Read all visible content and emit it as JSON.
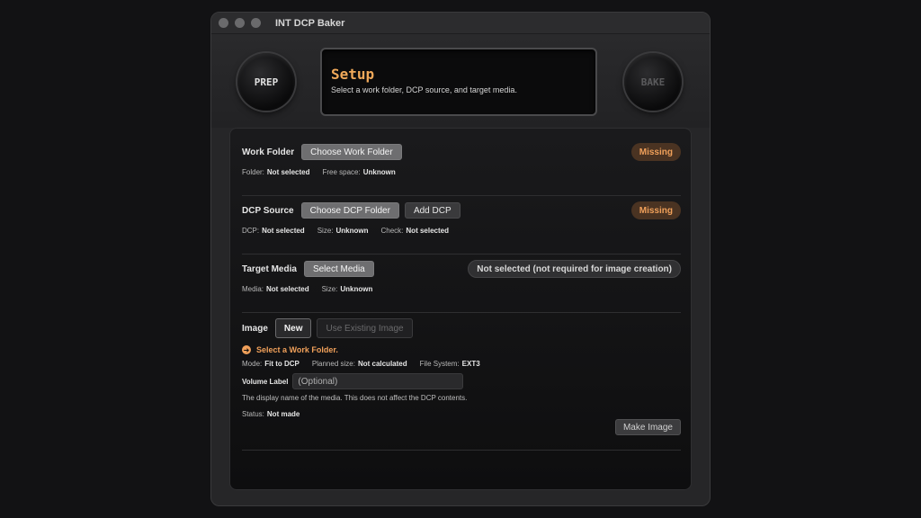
{
  "window": {
    "title": "INT DCP Baker"
  },
  "header": {
    "prep_label": "PREP",
    "bake_label": "BAKE",
    "display_title": "Setup",
    "display_subtitle": "Select a work folder, DCP source, and target media."
  },
  "work_folder": {
    "label": "Work Folder",
    "choose_button": "Choose Work Folder",
    "badge": "Missing",
    "folder_label": "Folder:",
    "folder_value": "Not selected",
    "free_label": "Free space:",
    "free_value": "Unknown"
  },
  "dcp_source": {
    "label": "DCP Source",
    "choose_button": "Choose DCP Folder",
    "add_button": "Add DCP",
    "badge": "Missing",
    "dcp_label": "DCP:",
    "dcp_value": "Not selected",
    "size_label": "Size:",
    "size_value": "Unknown",
    "check_label": "Check:",
    "check_value": "Not selected"
  },
  "target_media": {
    "label": "Target Media",
    "select_button": "Select Media",
    "badge": "Not selected (not required for image creation)",
    "media_label": "Media:",
    "media_value": "Not selected",
    "size_label": "Size:",
    "size_value": "Unknown"
  },
  "image": {
    "label": "Image",
    "new_button": "New",
    "existing_button": "Use Existing Image",
    "warning": "Select a Work Folder.",
    "mode_label": "Mode:",
    "mode_value": "Fit to DCP",
    "planned_label": "Planned size:",
    "planned_value": "Not calculated",
    "fs_label": "File System:",
    "fs_value": "EXT3",
    "volume_label": "Volume Label",
    "volume_placeholder": "(Optional)",
    "volume_note": "The display name of the media. This does not affect the DCP contents.",
    "status_label": "Status:",
    "status_value": "Not made",
    "make_button": "Make Image"
  },
  "colors": {
    "accent": "#f0a95a",
    "missing_bg": "#4a3322"
  }
}
